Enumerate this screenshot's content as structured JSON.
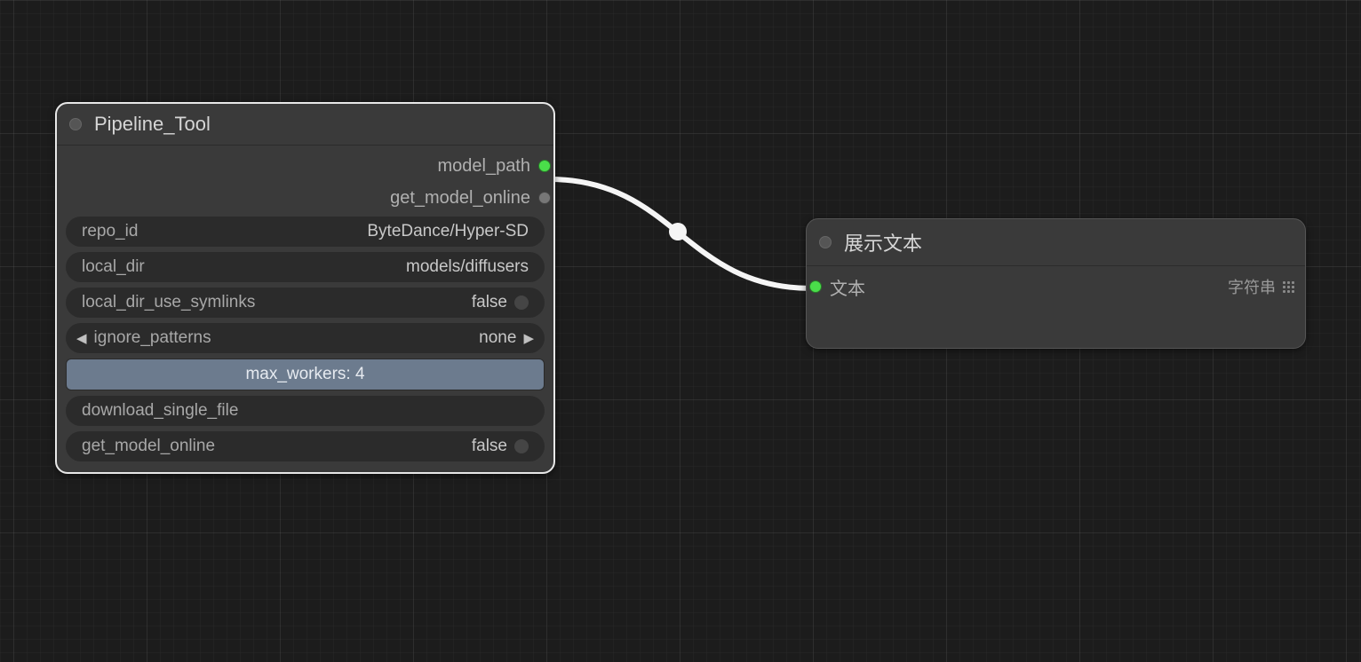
{
  "node1": {
    "title": "Pipeline_Tool",
    "outputs": {
      "model_path": "model_path",
      "get_model_online": "get_model_online"
    },
    "widgets": {
      "repo_id": {
        "label": "repo_id",
        "value": "ByteDance/Hyper-SD"
      },
      "local_dir": {
        "label": "local_dir",
        "value": "models/diffusers"
      },
      "local_dir_use_symlinks": {
        "label": "local_dir_use_symlinks",
        "value": "false"
      },
      "ignore_patterns": {
        "label": "ignore_patterns",
        "value": "none"
      },
      "max_workers": {
        "combined": "max_workers: 4"
      },
      "download_single_file": {
        "label": "download_single_file"
      },
      "get_model_online": {
        "label": "get_model_online",
        "value": "false"
      }
    }
  },
  "node2": {
    "title": "展示文本",
    "input_label": "文本",
    "type_label": "字符串"
  }
}
